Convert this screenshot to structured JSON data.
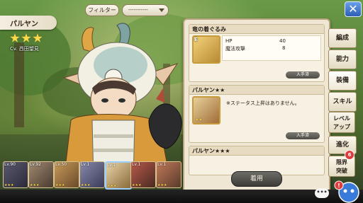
{
  "character": {
    "name": "パルヤン",
    "stars": 3,
    "cv": "Cv. 西田望見"
  },
  "filter": {
    "label": "フィルター",
    "selected": "-----------"
  },
  "panel": {
    "items": [
      {
        "title": "竜の着ぐるみ",
        "stats": [
          {
            "name": "HP",
            "value": "40"
          },
          {
            "name": "魔法攻撃",
            "value": "8"
          }
        ],
        "acquired": "入手済",
        "thumb_label": "E"
      },
      {
        "title": "パルヤン★★",
        "note": "※ステータス上昇はありません。",
        "acquired": "入手済",
        "thumb_label": "★★"
      },
      {
        "title": "パルヤン★★★"
      }
    ],
    "equip_button": "着用"
  },
  "tabs": [
    {
      "label": "編成"
    },
    {
      "label": "能力"
    },
    {
      "label": "装備"
    },
    {
      "label": "スキル"
    },
    {
      "label": "レベル\nアップ"
    },
    {
      "label": "進化"
    },
    {
      "label": "限界\n突破"
    }
  ],
  "limit_badge": "6",
  "roster": [
    {
      "level": "Lv.90",
      "stars": "★★★"
    },
    {
      "level": "Lv.92",
      "stars": "★★★"
    },
    {
      "level": "Lv.50",
      "stars": "★★★"
    },
    {
      "level": "Lv.1",
      "stars": "★★★"
    },
    {
      "level": "Lv.1",
      "stars": "★★★"
    },
    {
      "level": "Lv.1",
      "stars": "★★★"
    },
    {
      "level": "Lv.1",
      "stars": "★★★"
    }
  ],
  "chat": "•••",
  "colors": {
    "panel_bg": "#efe7d3",
    "tab_border": "#9c8a60",
    "close_blue": "#2c5fb6",
    "badge_red": "#e23a3a",
    "star": "#ffd84a"
  }
}
